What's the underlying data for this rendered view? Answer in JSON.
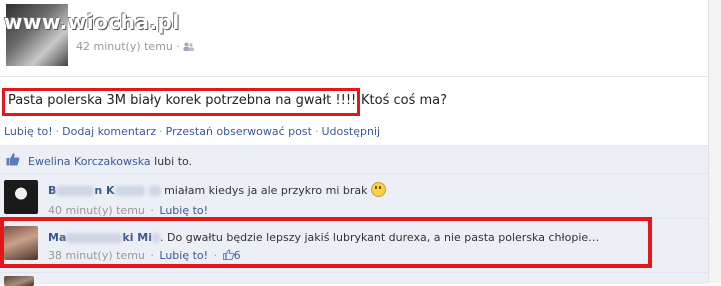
{
  "header": {
    "watermark": "www.wiocha.pl",
    "time": "42 minut(y) temu",
    "dot": "·"
  },
  "post": {
    "text_highlighted": "Pasta polerska 3M biały korek potrzebna na gwałt !!!!",
    "text_rest": "Ktoś coś ma?"
  },
  "actions": {
    "like": "Lubię to!",
    "comment": "Dodaj komentarz",
    "unfollow": "Przestań obserwować post",
    "share": "Udostępnij",
    "sep": "·"
  },
  "likes": {
    "name": "Ewelina Korczakowska",
    "suffix": "lubi to."
  },
  "comments": [
    {
      "author_prefix": "B",
      "author_mid": "n K",
      "text": "miałam kiedys ja ale przykro mi brak",
      "time": "40 minut(y) temu",
      "like": "Lubię to!"
    },
    {
      "author_prefix": "Ma",
      "author_mid": "ki Mi",
      "text": ". Do gwałtu będzie lepszy jakiś lubrykant durexa, a nie pasta polerska chłopie…",
      "time": "38 minut(y) temu",
      "like": "Lubię to!",
      "like_count": "6"
    }
  ],
  "colors": {
    "highlight": "#e3161a",
    "link": "#3b5998",
    "comment_bg": "#eceff5"
  }
}
